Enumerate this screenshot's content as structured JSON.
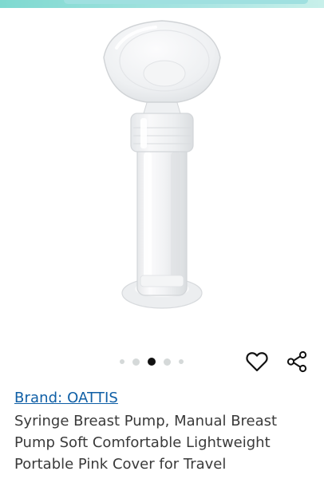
{
  "carousel": {
    "dot_count": 5,
    "active_index": 2
  },
  "actions": {
    "wishlist_icon": "heart-outline-icon",
    "share_icon": "share-icon"
  },
  "product": {
    "brand_label": "Brand: OATTIS",
    "title": "Syringe Breast Pump, Manual Breast Pump Soft Comfortable Lightweight Portable Pink Cover for Travel"
  },
  "colors": {
    "brand_link": "#0f5fa6",
    "title_text": "#3a3a3a",
    "active_dot": "#111111",
    "inactive_dot": "#d5d9d9",
    "top_banner": "#a8e4e2"
  }
}
